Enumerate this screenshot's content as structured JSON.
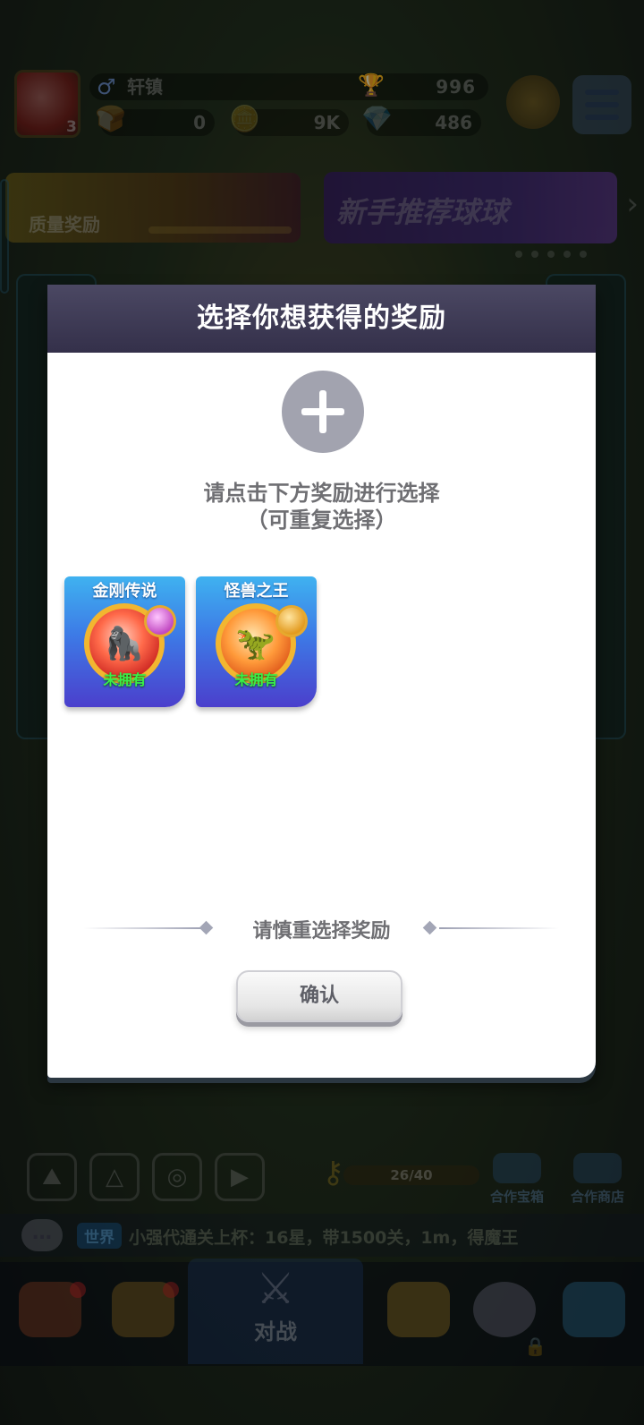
{
  "hud": {
    "player_name": "轩镇",
    "gender_icon": "male-icon",
    "trophy_score": "996",
    "level": "3",
    "resources": [
      {
        "icon": "bread-icon",
        "value": "0"
      },
      {
        "icon": "coin-icon",
        "value": "9K"
      },
      {
        "icon": "gem-icon",
        "value": "486"
      }
    ]
  },
  "banners": {
    "left_label": "质量奖励",
    "right_label": "新手推荐球球"
  },
  "bottom": {
    "xp_progress": "26/40",
    "shop_buttons": [
      "合作宝箱",
      "合作商店"
    ]
  },
  "chat": {
    "channel": "世界",
    "message": "小强代通关上杯：16星，带1500关，1m，得魔王"
  },
  "tabbar": {
    "battle_label": "对战"
  },
  "dialog": {
    "title": "选择你想获得的奖励",
    "hint_line1": "请点击下方奖励进行选择",
    "hint_line2": "（可重复选择）",
    "rewards": [
      {
        "title": "金刚传说",
        "status": "未拥有"
      },
      {
        "title": "怪兽之王",
        "status": "未拥有"
      }
    ],
    "warning": "请慎重选择奖励",
    "confirm_label": "确认"
  },
  "colors": {
    "header_bg": "#3e3b55",
    "plus_circle": "#a2a3af",
    "owned_status_green": "#39f049"
  }
}
